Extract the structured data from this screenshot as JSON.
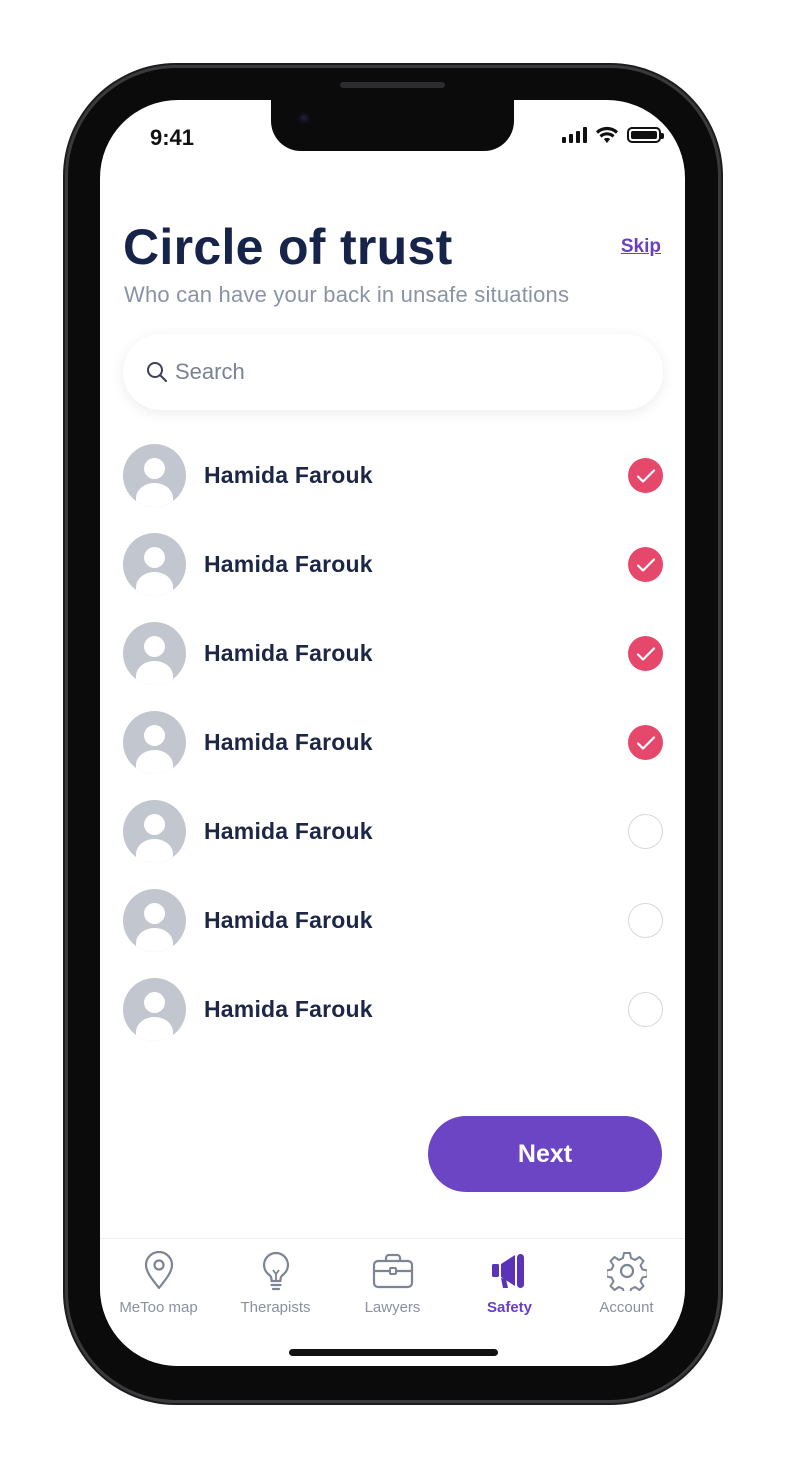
{
  "status_bar": {
    "time": "9:41"
  },
  "header": {
    "title": "Circle of trust",
    "skip_label": "Skip",
    "subtitle": "Who can have your back in unsafe situations"
  },
  "search": {
    "placeholder": "Search",
    "value": ""
  },
  "contacts": [
    {
      "name": "Hamida Farouk",
      "selected": true
    },
    {
      "name": "Hamida Farouk",
      "selected": true
    },
    {
      "name": "Hamida Farouk",
      "selected": true
    },
    {
      "name": "Hamida Farouk",
      "selected": true
    },
    {
      "name": "Hamida Farouk",
      "selected": false
    },
    {
      "name": "Hamida Farouk",
      "selected": false
    },
    {
      "name": "Hamida Farouk",
      "selected": false
    }
  ],
  "next_label": "Next",
  "tabs": [
    {
      "label": "MeToo map",
      "icon": "map-pin-icon",
      "active": false
    },
    {
      "label": "Therapists",
      "icon": "lightbulb-icon",
      "active": false
    },
    {
      "label": "Lawyers",
      "icon": "briefcase-icon",
      "active": false
    },
    {
      "label": "Safety",
      "icon": "megaphone-icon",
      "active": true
    },
    {
      "label": "Account",
      "icon": "gear-icon",
      "active": false
    }
  ],
  "colors": {
    "accent": "#6c45c4",
    "checked": "#e5486b",
    "title": "#17244a",
    "muted": "#8a93a6"
  }
}
